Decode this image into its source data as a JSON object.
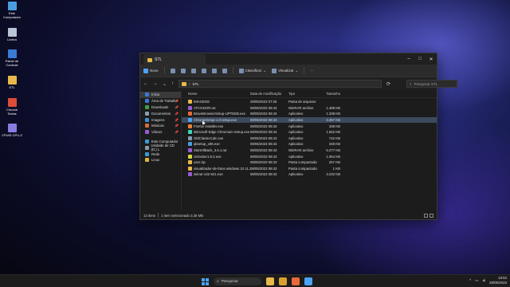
{
  "desktop": {
    "icons": [
      {
        "label": "Este Computador",
        "color": "#4a9de0",
        "icon": "computer-icon"
      },
      {
        "label": "Lixeira",
        "color": "#b9c4d4",
        "icon": "recycle-bin-icon"
      },
      {
        "label": "Painel de Controle",
        "color": "#3a7bd5",
        "icon": "control-panel-icon"
      },
      {
        "label": "STL",
        "color": "#e8b84a",
        "icon": "folder-icon"
      },
      {
        "label": "Chrome Teclas",
        "color": "#dd4b39",
        "icon": "chrome-icon"
      },
      {
        "label": "CPUID CPU-Z",
        "color": "#8a7be0",
        "icon": "cpuz-icon"
      }
    ]
  },
  "window": {
    "tab_title": "STL",
    "toolbar": {
      "new_label": "Novo",
      "sort_label": "Classificar",
      "view_label": "Visualizar",
      "more_label": "···"
    },
    "address": {
      "path": "STL",
      "search_placeholder": "Pesquisar STL"
    },
    "nav_pane": [
      {
        "label": "Início",
        "selected": true,
        "pinned": false,
        "color": "#3a78d8"
      },
      {
        "label": "Área de Trabalho",
        "selected": false,
        "pinned": true,
        "color": "#3a78d8"
      },
      {
        "label": "Downloads",
        "selected": false,
        "pinned": true,
        "color": "#3fa04a"
      },
      {
        "label": "Documentos",
        "selected": false,
        "pinned": true,
        "color": "#8a9ab0"
      },
      {
        "label": "Imagens",
        "selected": false,
        "pinned": true,
        "color": "#3f8fd8"
      },
      {
        "label": "Músicas",
        "selected": false,
        "pinned": true,
        "color": "#d86a3a"
      },
      {
        "label": "Vídeos",
        "selected": false,
        "pinned": true,
        "color": "#9a5ad8"
      },
      {
        "label": "Este Computador",
        "selected": false,
        "pinned": false,
        "color": "#3a9ad8",
        "gap_before": true
      },
      {
        "label": "Unidade de CD (D:) L",
        "selected": false,
        "pinned": false,
        "color": "#8a9ab0"
      },
      {
        "label": "Rede",
        "selected": false,
        "pinned": false,
        "color": "#3a9ad8"
      },
      {
        "label": "Linux",
        "selected": false,
        "pinned": false,
        "color": "#d8b83a"
      }
    ],
    "columns": {
      "name": "Nome",
      "date": "Data de modificação",
      "type": "Tipo",
      "size": "Tamanho"
    },
    "files": [
      {
        "name": "IMAGENS",
        "date": "29/05/2023 07:26",
        "type": "Pasta de arquivos",
        "size": "",
        "color": "#e8b84a",
        "selected": false
      },
      {
        "name": "ATIVADOR.rar",
        "date": "08/05/2023 08:43",
        "type": "WinRAR archive",
        "size": "1.489 KB",
        "color": "#9a5ad8",
        "selected": false
      },
      {
        "name": "BraveBrowserSetup-UPTEEB.exe",
        "date": "08/05/2023 08:43",
        "type": "Aplicativo",
        "size": "1.338 KB",
        "color": "#e86a3a",
        "selected": false
      },
      {
        "name": "ChromeSetup-1.0-setup.exe",
        "date": "08/05/2023 08:43",
        "type": "Aplicativo",
        "size": "3.457 KB",
        "color": "#4ca3f5",
        "selected": true
      },
      {
        "name": "Firefox Installer.exe",
        "date": "08/05/2023 08:43",
        "type": "Aplicativo",
        "size": "339 KB",
        "color": "#e8823a",
        "selected": false
      },
      {
        "name": "Microsoft Edge Chromium Setup.exe",
        "date": "08/05/2023 08:43",
        "type": "Aplicativo",
        "size": "1.552 KB",
        "color": "#3ad8b8",
        "selected": false
      },
      {
        "name": "OldClassicCalc.exe",
        "date": "08/05/2023 08:43",
        "type": "Aplicativo",
        "size": "742 KB",
        "color": "#8a9ab0",
        "selected": false
      },
      {
        "name": "qbsetup_x86.exe",
        "date": "08/05/2023 08:43",
        "type": "Aplicativo",
        "size": "348 KB",
        "color": "#4a9de0",
        "selected": false
      },
      {
        "name": "StartAllBack_3.6.1.rar",
        "date": "08/05/2023 08:43",
        "type": "WinRAR archive",
        "size": "5.277 KB",
        "color": "#9a5ad8",
        "selected": false
      },
      {
        "name": "Unlocker1.9.2.exe",
        "date": "08/05/2023 08:43",
        "type": "Aplicativo",
        "size": "1.054 KB",
        "color": "#d8d83a",
        "selected": false
      },
      {
        "name": "user.zip",
        "date": "08/05/2023 08:43",
        "type": "Pasta compactada",
        "size": "257 KB",
        "color": "#e8b84a",
        "selected": false
      },
      {
        "name": "visualizador-de-fotos windows 10 11.zip",
        "date": "08/05/2023 08:43",
        "type": "Pasta compactada",
        "size": "1 KB",
        "color": "#e8b84a",
        "selected": false
      },
      {
        "name": "winrar-x32-621.exe",
        "date": "08/05/2023 08:43",
        "type": "Aplicativo",
        "size": "3.232 KB",
        "color": "#9a5ad8",
        "selected": false
      }
    ],
    "status": {
      "items": "13 itens",
      "selection": "1 item selecionado  3,38 MB"
    }
  },
  "taskbar": {
    "search_label": "Pesquisar",
    "apps": [
      {
        "icon": "file-explorer-icon",
        "color": "#e8b84a"
      },
      {
        "icon": "folder-icon",
        "color": "#d8a030"
      },
      {
        "icon": "media-icon",
        "color": "#e86a3a"
      },
      {
        "icon": "store-icon",
        "color": "#4ca3f5"
      }
    ],
    "time": "18:53",
    "date": "28/05/2023"
  }
}
